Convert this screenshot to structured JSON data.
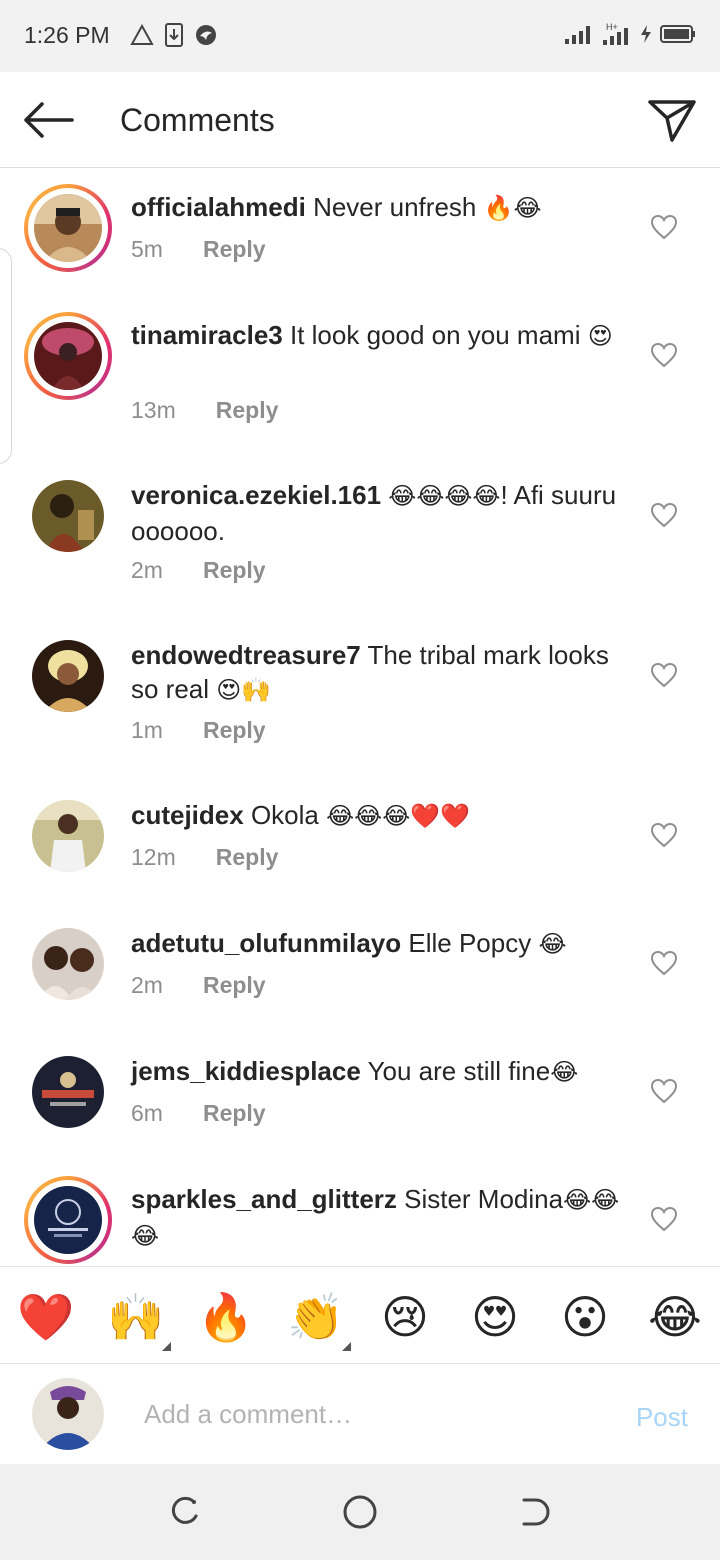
{
  "status_bar": {
    "time": "1:26 PM",
    "left_icons": [
      "warning-triangle-icon",
      "download-icon",
      "bird-app-icon"
    ],
    "right_icons": [
      "signal-icon",
      "hplus-signal-icon",
      "charging-icon",
      "battery-icon"
    ]
  },
  "header": {
    "title": "Comments",
    "back_icon": "arrow-left-icon",
    "share_icon": "send-icon"
  },
  "comments": [
    {
      "username": "officialahmedi",
      "text": "Never unfresh",
      "emoji": "🔥😂",
      "time": "5m",
      "reply": "Reply",
      "ring": true
    },
    {
      "username": "tinamiracle3",
      "text": "It look good on you mami",
      "emoji": "😍",
      "time": "13m",
      "reply": "Reply",
      "ring": true
    },
    {
      "username": "veronica.ezekiel.161",
      "text": "! Afi suuru oooooo.",
      "emoji": "😂😂😂😂",
      "time": "2m",
      "reply": "Reply",
      "ring": false
    },
    {
      "username": "endowedtreasure7",
      "text": "The tribal mark looks so real",
      "emoji": "😍🙌",
      "time": "1m",
      "reply": "Reply",
      "ring": false
    },
    {
      "username": "cutejidex",
      "text": "Okola",
      "emoji": "😂😂😂❤️❤️",
      "time": "12m",
      "reply": "Reply",
      "ring": false
    },
    {
      "username": "adetutu_olufunmilayo",
      "text": "Elle Popcy",
      "emoji": "😂",
      "time": "2m",
      "reply": "Reply",
      "ring": false
    },
    {
      "username": "jems_kiddiesplace",
      "text": "You are still fine",
      "emoji": "😂",
      "time": "6m",
      "reply": "Reply",
      "ring": false
    },
    {
      "username": "sparkles_and_glitterz",
      "text": "Sister Modina",
      "emoji": "😂😂😂",
      "time": "",
      "reply": "",
      "ring": true
    }
  ],
  "emoji_bar": [
    "❤️",
    "🙌",
    "🔥",
    "👏",
    "😢",
    "😍",
    "😮",
    "😂"
  ],
  "composer": {
    "placeholder": "Add a comment…",
    "post_label": "Post"
  },
  "colors": {
    "post_disabled": "#a8d4f5",
    "meta_gray": "#8e8e8e",
    "text": "#262626"
  }
}
